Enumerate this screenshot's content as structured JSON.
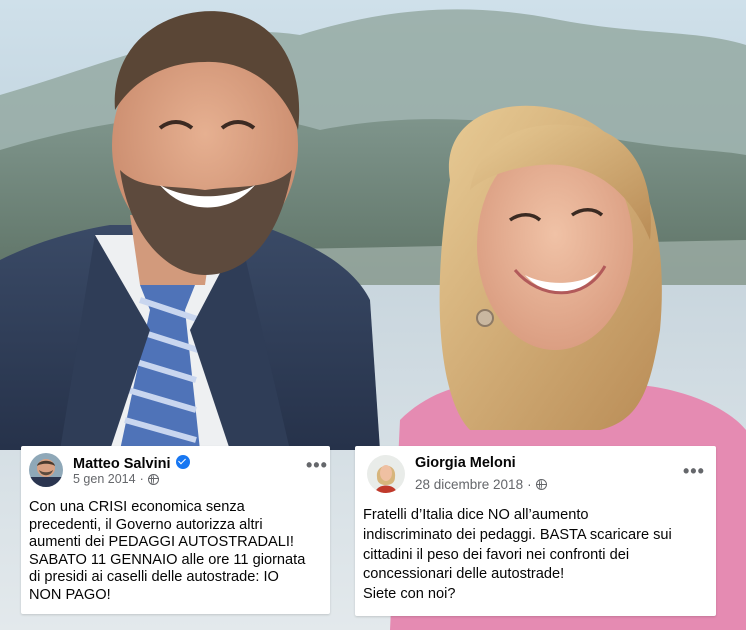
{
  "posts": {
    "salvini": {
      "author": "Matteo Salvini",
      "date": "5 gen 2014",
      "text_lines": [
        "Con una CRISI economica senza",
        "precedenti, il Governo autorizza altri",
        "aumenti dei PEDAGGI AUTOSTRADALI!",
        "SABATO 11 GENNAIO alle ore 11 giornata",
        "di presidi ai caselli delle autostrade: IO",
        "NON PAGO!"
      ],
      "more_label": "•••"
    },
    "meloni": {
      "author": "Giorgia Meloni",
      "date": "28 dicembre 2018",
      "separator": "·",
      "text_lines": [
        "Fratelli d’Italia dice NO all’aumento",
        "indiscriminato dei pedaggi. BASTA scaricare sui",
        "cittadini il peso dei favori nei confronti dei",
        "concessionari delle autostrade!",
        "Siete con noi?"
      ],
      "more_label": "•••"
    }
  },
  "colors": {
    "verified_badge": "#1877f2",
    "text_primary": "#050505",
    "text_secondary": "#65676b"
  },
  "icons": [
    "verified-badge-icon",
    "globe-icon",
    "more-options-icon"
  ]
}
